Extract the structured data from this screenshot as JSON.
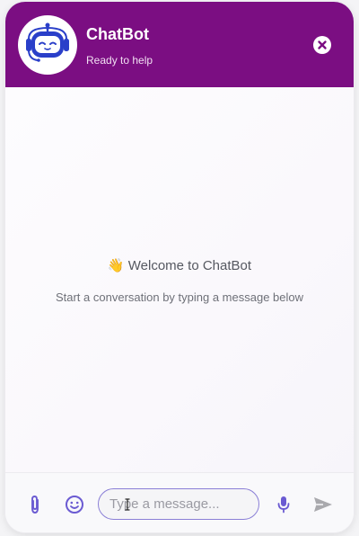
{
  "header": {
    "bot_name": "ChatBot",
    "status": "Ready to help",
    "avatar_icon": "robot-icon",
    "close_icon": "close-icon",
    "background": "#7b0e82"
  },
  "messages": {
    "welcome_text": "👋 Welcome to ChatBot",
    "hint_text": "Start a conversation by typing a message below"
  },
  "composer": {
    "placeholder": "Type a message...",
    "value": "",
    "attach_icon": "paperclip-icon",
    "emoji_icon": "smiley-icon",
    "mic_icon": "microphone-icon",
    "send_icon": "send-icon",
    "accent": "#6b5bd2"
  }
}
